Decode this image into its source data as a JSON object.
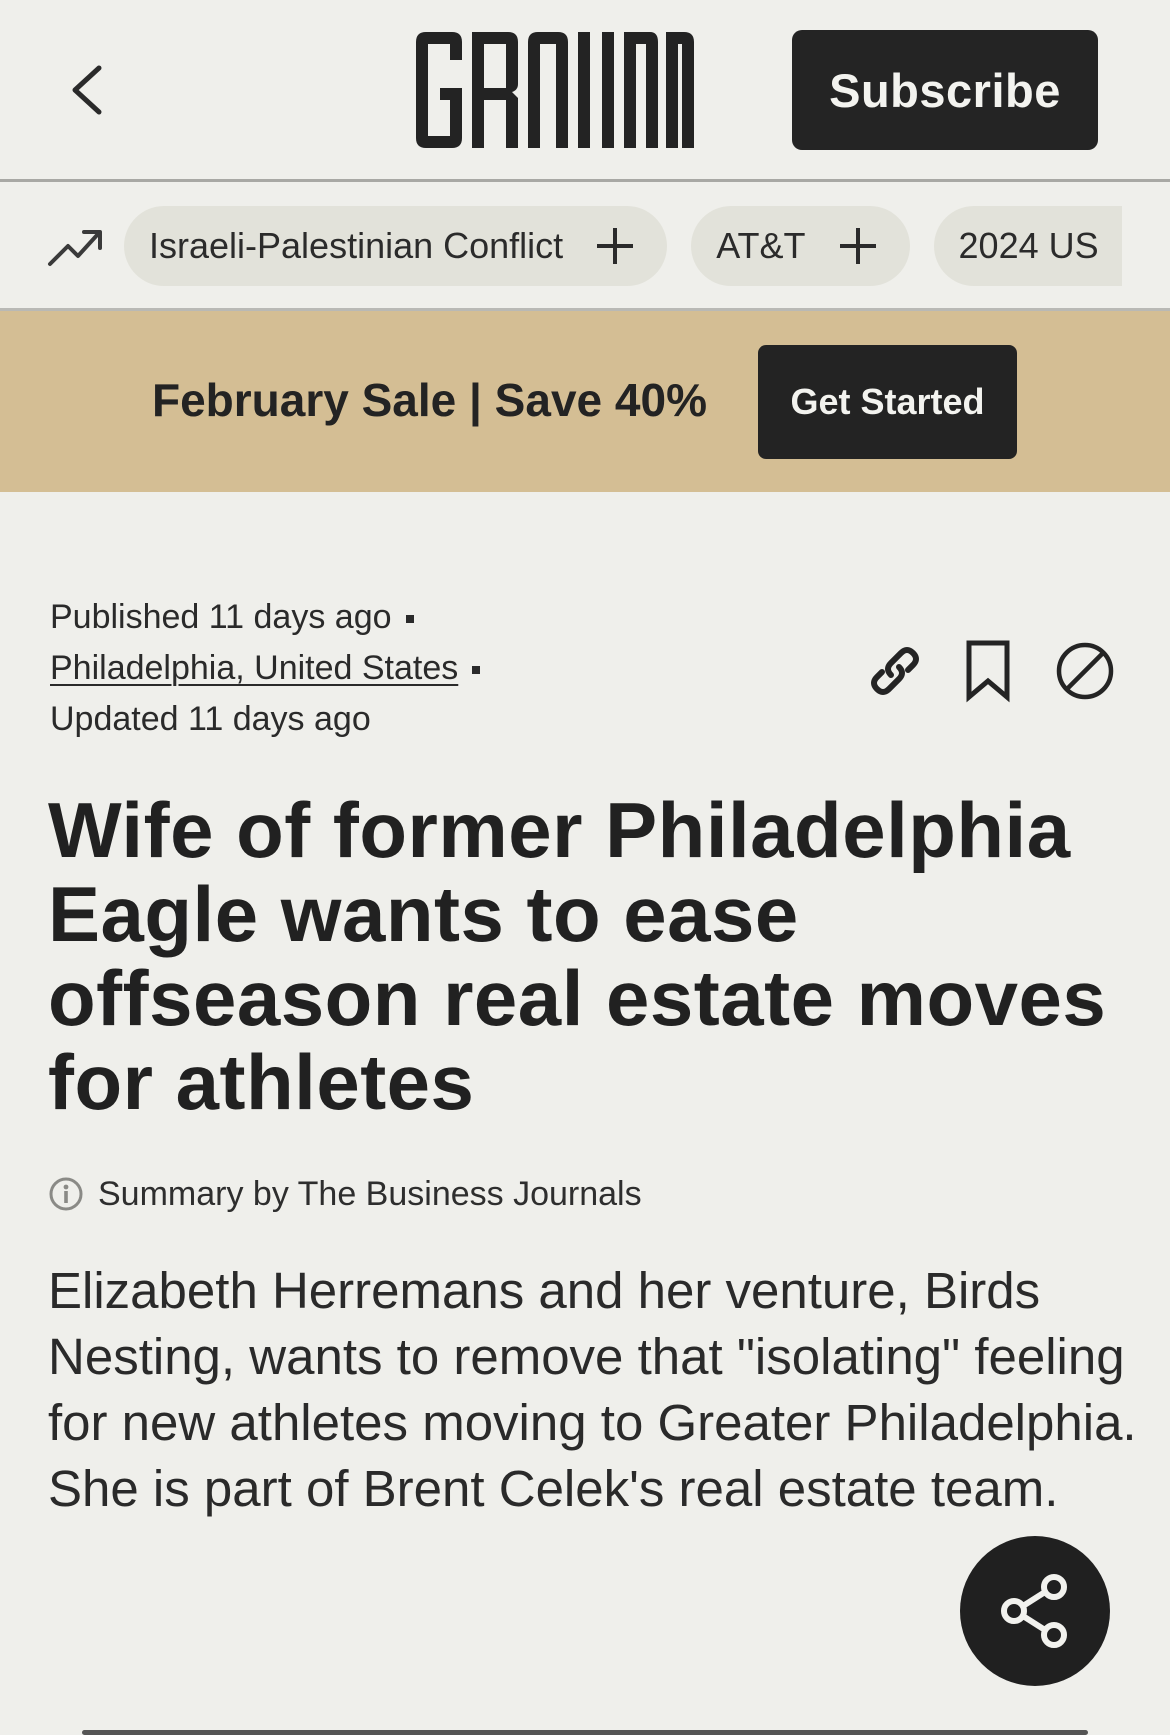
{
  "header": {
    "logo_text": "GROUND",
    "subscribe_label": "Subscribe"
  },
  "topics": [
    {
      "label": "Israeli-Palestinian Conflict"
    },
    {
      "label": "AT&T"
    },
    {
      "label": "2024 US"
    }
  ],
  "promo": {
    "text": "February Sale | Save 40%",
    "button_label": "Get Started",
    "background": "#d4be94"
  },
  "article": {
    "published": "Published 11 days ago",
    "location": "Philadelphia, United States",
    "updated": "Updated 11 days ago",
    "headline": "Wife of former Philadelphia Eagle wants to ease offseason real estate moves for athletes",
    "summary_by": "Summary by The Business Journals",
    "summary": "Elizabeth Herremans and her venture, Birds Nesting, wants to remove that \"isolating\" feeling for new athletes moving to Greater Philadelphia. She is part of Brent Celek's real estate team."
  },
  "icons": {
    "back": "chevron-left-icon",
    "trending": "trending-up-icon",
    "link": "link-icon",
    "bookmark": "bookmark-icon",
    "block": "block-icon",
    "info": "info-icon",
    "share": "share-icon"
  },
  "colors": {
    "background": "#efefeb",
    "dark": "#232323",
    "chip": "#e2e2da"
  }
}
